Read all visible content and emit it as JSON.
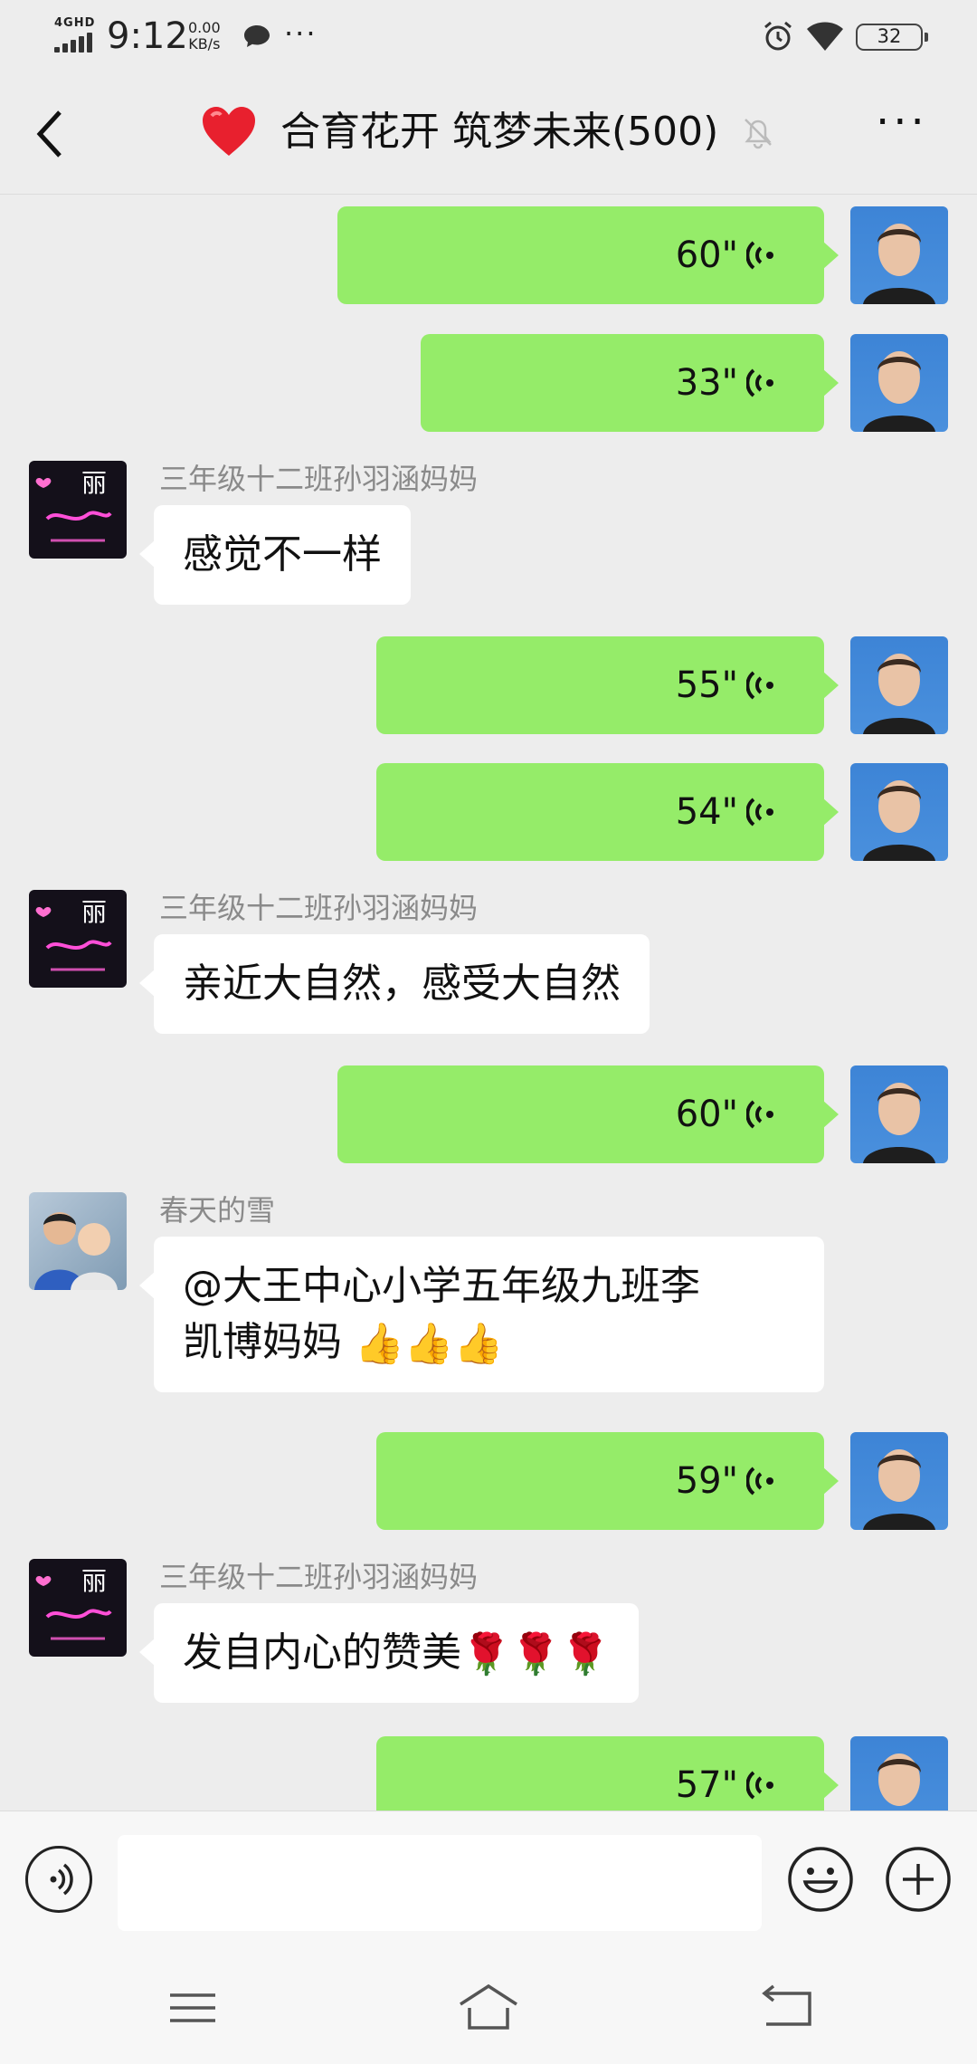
{
  "status_bar": {
    "network": "4GHD",
    "time": "9:12",
    "speed_value": "0.00",
    "speed_unit": "KB/s",
    "more": "···",
    "battery": "32"
  },
  "header": {
    "title": "合育花开 筑梦未来(500)",
    "back_icon": "chevron-left-icon",
    "heart_icon": "red-heart-icon",
    "mute_icon": "bell-off-icon",
    "menu_icon": "more-horizontal-icon"
  },
  "messages": [
    {
      "type": "voice",
      "duration": "60\""
    },
    {
      "type": "voice",
      "duration": "33\""
    },
    {
      "type": "text",
      "sender": "三年级十二班孙羽涵妈妈",
      "text": "感觉不一样"
    },
    {
      "type": "voice",
      "duration": "55\""
    },
    {
      "type": "voice",
      "duration": "54\""
    },
    {
      "type": "text",
      "sender": "三年级十二班孙羽涵妈妈",
      "text": "亲近大自然，感受大自然"
    },
    {
      "type": "voice",
      "duration": "60\""
    },
    {
      "type": "text",
      "sender": "春天的雪",
      "text_line1": "@大王中心小学五年级九班李",
      "text_line2": "凯博妈妈 ",
      "emoji": "👍👍👍"
    },
    {
      "type": "voice",
      "duration": "59\""
    },
    {
      "type": "text",
      "sender": "三年级十二班孙羽涵妈妈",
      "text": "发自内心的赞美",
      "emoji": "🌹🌹🌹"
    },
    {
      "type": "voice",
      "duration": "57\""
    }
  ],
  "avatar_li_text": "丽",
  "colors": {
    "voice_bubble": "#95ec69",
    "background": "#ededed",
    "text_bubble": "#ffffff"
  }
}
